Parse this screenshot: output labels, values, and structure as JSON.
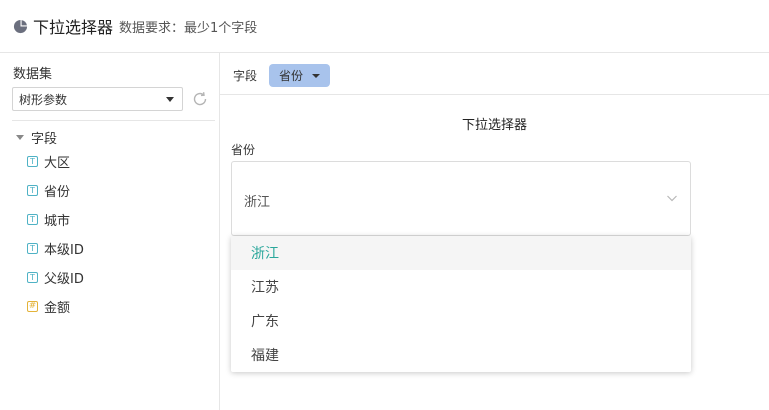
{
  "header": {
    "title": "下拉选择器",
    "requirement": "数据要求：最少1个字段",
    "icon": "pie-chart-icon"
  },
  "sidebar": {
    "dataset_label": "数据集",
    "dataset_value": "树形参数",
    "tree_root": "字段",
    "fields": [
      {
        "label": "大区",
        "type": "text",
        "icon": "T"
      },
      {
        "label": "省份",
        "type": "text",
        "icon": "T"
      },
      {
        "label": "城市",
        "type": "text",
        "icon": "T"
      },
      {
        "label": "本级ID",
        "type": "text",
        "icon": "T"
      },
      {
        "label": "父级ID",
        "type": "text",
        "icon": "T"
      },
      {
        "label": "金额",
        "type": "number",
        "icon": "#"
      }
    ]
  },
  "main": {
    "field_bar_label": "字段",
    "field_chip": "省份",
    "widget_title": "下拉选择器",
    "widget_label": "省份",
    "selected_value": "浙江",
    "options": [
      "浙江",
      "江苏",
      "广东",
      "福建"
    ]
  },
  "colors": {
    "chip_bg": "#a8c3ec",
    "selected_option": "#2aa79b",
    "text_field_icon": "#4fb2c5",
    "number_field_icon": "#e3b339"
  }
}
